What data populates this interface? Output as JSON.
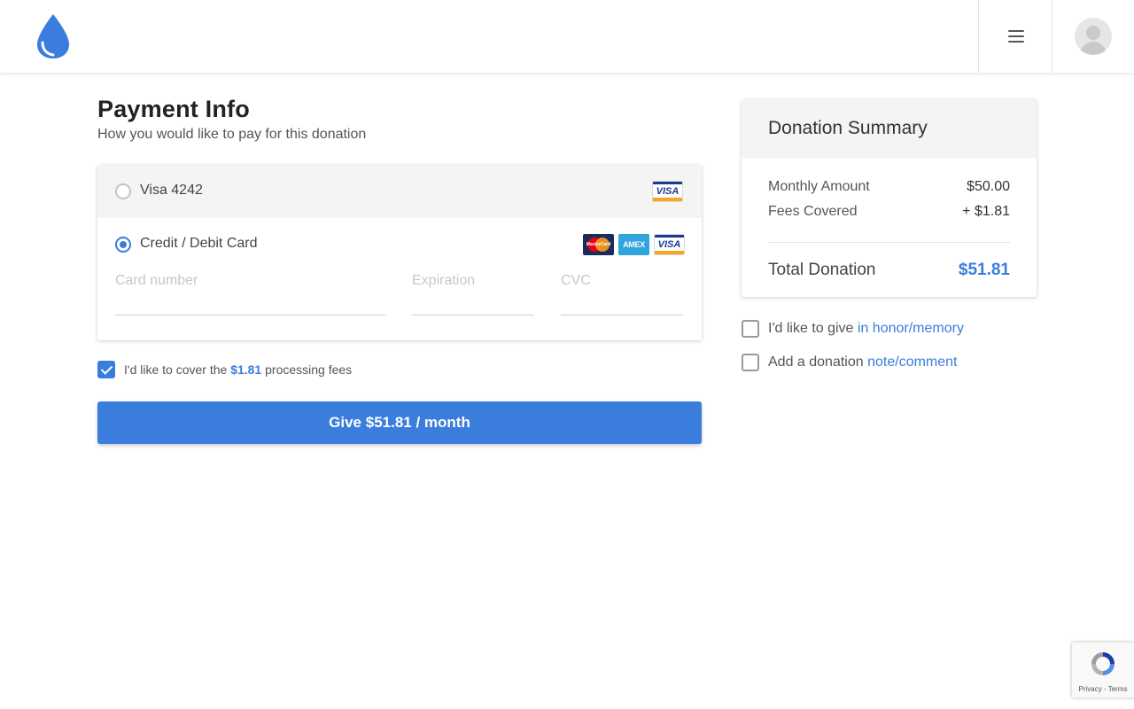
{
  "header": {
    "logo_icon": "water-drop-icon",
    "menu_icon": "hamburger-menu-icon",
    "avatar_icon": "user-avatar-icon",
    "brand_color": "#3b7ddd"
  },
  "payment": {
    "title": "Payment Info",
    "subtitle": "How you would like to pay for this donation",
    "saved_card_label": "Visa 4242",
    "saved_card_brand": "VISA",
    "new_card_label": "Credit / Debit Card",
    "card_brands": [
      "MasterCard",
      "AMEX",
      "VISA"
    ],
    "fields": {
      "card_number_placeholder": "Card number",
      "expiration_placeholder": "Expiration",
      "cvc_placeholder": "CVC"
    },
    "fees": {
      "prefix": "I'd like to cover the",
      "amount": "$1.81",
      "suffix": "processing fees",
      "checked": true
    },
    "give_button": "Give $51.81 / month"
  },
  "summary": {
    "title": "Donation Summary",
    "monthly_label": "Monthly Amount",
    "monthly_value": "$50.00",
    "fees_label": "Fees Covered",
    "fees_value": "+ $1.81",
    "total_label": "Total Donation",
    "total_value": "$51.81"
  },
  "options": {
    "honor_prefix": "I'd like to give",
    "honor_link": "in honor/memory",
    "note_prefix": "Add a donation",
    "note_link": "note/comment"
  },
  "recaptcha": {
    "text": "Privacy - Terms"
  }
}
